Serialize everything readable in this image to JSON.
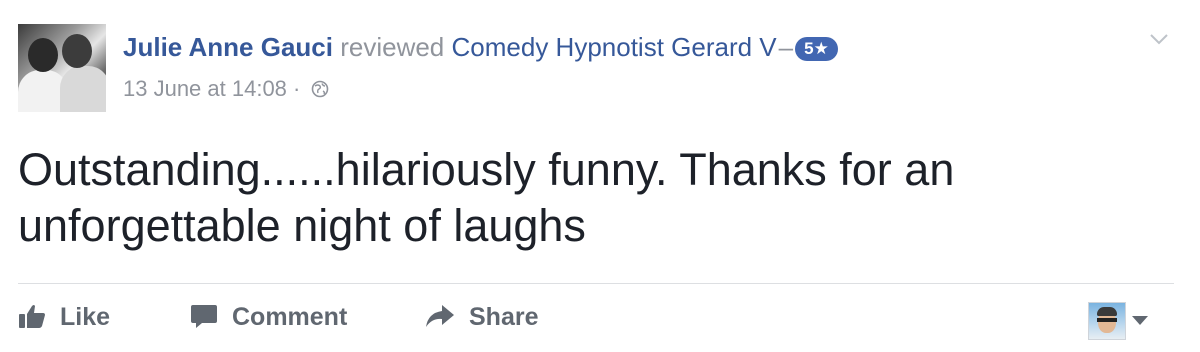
{
  "post": {
    "author": "Julie Anne Gauci",
    "action_text": "reviewed",
    "target": "Comedy Hypnotist Gerard V",
    "separator": "–",
    "rating": "5★",
    "timestamp": "13 June at 14:08",
    "meta_separator": "·",
    "privacy_icon": "globe-icon",
    "review_text": "Outstanding......hilariously funny. Thanks for an unforgettable night of laughs"
  },
  "actions": {
    "like_label": "Like",
    "comment_label": "Comment",
    "share_label": "Share"
  },
  "colors": {
    "link": "#365899",
    "meta": "#90949c",
    "badge": "#4267b2",
    "text": "#1d2129",
    "action": "#606770"
  }
}
